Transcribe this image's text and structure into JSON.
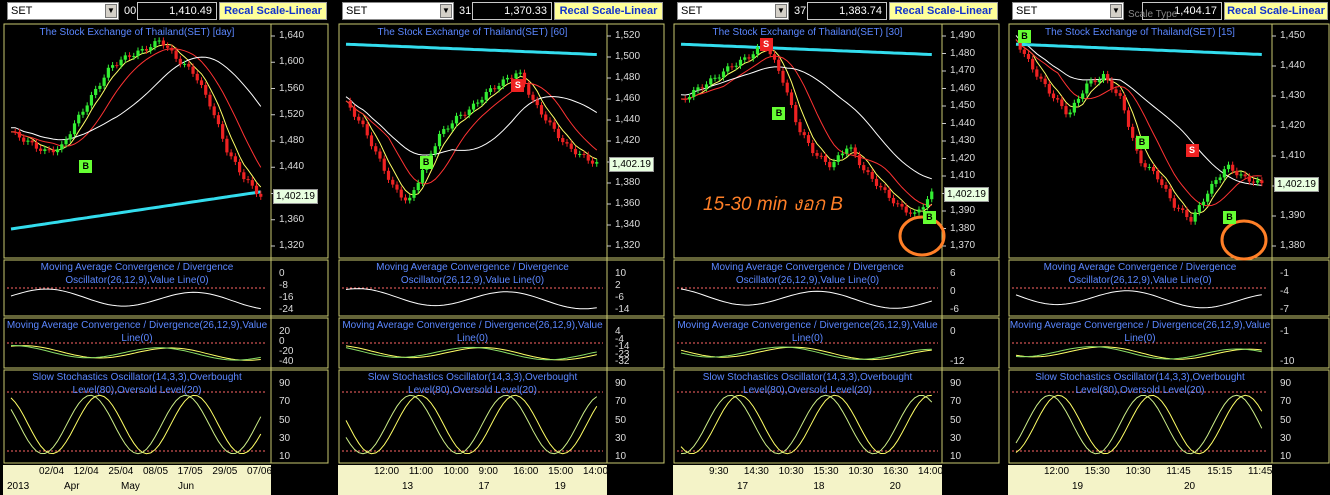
{
  "panels": [
    {
      "symbol": "SET",
      "price_tail": "00",
      "price": "1,410.49",
      "scale_label": "Recal Scale-Linear",
      "title": "The Stock Exchange of Thailand(SET) [day]",
      "price_ticks": [
        "1,640",
        "1,600",
        "1,560",
        "1,520",
        "1,480",
        "1,440",
        "1,400",
        "1,360",
        "1,320"
      ],
      "last_price": "1,402.19",
      "signals": [
        {
          "label": "B"
        }
      ],
      "macd1_title": "Moving Average Convergence / Divergence Oscillator(26,12,9),Value Line(0)",
      "macd1_ticks": [
        "0",
        "-8",
        "-16",
        "-24"
      ],
      "macd2_title": "Moving Average Convergence / Divergence(26,12,9),Value Line(0)",
      "macd2_ticks": [
        "20",
        "0",
        "-20",
        "-40"
      ],
      "stoch_title": "Slow Stochastics Oscillator(14,3,3),Overbought Level(80),Oversold Level(20)",
      "stoch_ticks": [
        "90",
        "70",
        "50",
        "30",
        "10"
      ],
      "time_top": [
        "02/04",
        "12/04",
        "25/04",
        "08/05",
        "17/05",
        "29/05",
        "07/06"
      ],
      "time_bottom": [
        "2013",
        "Apr",
        "May",
        "Jun"
      ]
    },
    {
      "symbol": "SET",
      "price_tail": "31",
      "price": "1,370.33",
      "scale_label": "Recal Scale-Linear",
      "title": "The Stock Exchange of Thailand(SET) [60]",
      "price_ticks": [
        "1,520",
        "1,500",
        "1,480",
        "1,460",
        "1,440",
        "1,420",
        "1,400",
        "1,380",
        "1,360",
        "1,340",
        "1,320"
      ],
      "last_price": "1,402.19",
      "signals": [
        {
          "label": "B"
        },
        {
          "label": "S"
        }
      ],
      "macd1_title": "Moving Average Convergence / Divergence Oscillator(26,12,9),Value Line(0)",
      "macd1_ticks": [
        "10",
        "2",
        "-6",
        "-14"
      ],
      "macd2_title": "Moving Average Convergence / Divergence(26,12,9),Value Line(0)",
      "macd2_ticks": [
        "4",
        "-4",
        "-14",
        "-23",
        "-32"
      ],
      "stoch_title": "Slow Stochastics Oscillator(14,3,3),Overbought Level(80),Oversold Level(20)",
      "stoch_ticks": [
        "90",
        "70",
        "50",
        "30",
        "10"
      ],
      "time_top": [
        "12:00",
        "11:00",
        "10:00",
        "9:00",
        "16:00",
        "15:00",
        "14:00"
      ],
      "time_bottom": [
        "13",
        "17",
        "19"
      ]
    },
    {
      "symbol": "SET",
      "price_tail": "37",
      "price": "1,383.74",
      "scale_label": "Recal Scale-Linear",
      "title": "The Stock Exchange of Thailand(SET) [30]",
      "price_ticks": [
        "1,490",
        "1,480",
        "1,470",
        "1,460",
        "1,450",
        "1,440",
        "1,430",
        "1,420",
        "1,410",
        "1,400",
        "1,390",
        "1,380",
        "1,370"
      ],
      "last_price": "1,402.19",
      "signals": [
        {
          "label": "S"
        },
        {
          "label": "B"
        },
        {
          "label": "B"
        }
      ],
      "annotation": "15-30 min งอก B",
      "macd1_title": "Moving Average Convergence / Divergence Oscillator(26,12,9),Value Line(0)",
      "macd1_ticks": [
        "6",
        "0",
        "-6"
      ],
      "macd2_title": "Moving Average Convergence / Divergence(26,12,9),Value Line(0)",
      "macd2_ticks": [
        "0",
        "-12"
      ],
      "stoch_title": "Slow Stochastics Oscillator(14,3,3),Overbought Level(80),Oversold Level(20)",
      "stoch_ticks": [
        "90",
        "70",
        "50",
        "30",
        "10"
      ],
      "time_top": [
        "9:30",
        "14:30",
        "10:30",
        "15:30",
        "10:30",
        "16:30",
        "14:00"
      ],
      "time_bottom": [
        "17",
        "18",
        "20"
      ]
    },
    {
      "symbol": "SET",
      "price_tail": "",
      "price": "1,404.17",
      "scale_label": "Recal Scale-Linear",
      "title": "The Stock Exchange of Thailand(SET) [15]",
      "overlay_text": "Scale Type",
      "price_ticks": [
        "1,450",
        "1,440",
        "1,430",
        "1,420",
        "1,410",
        "1,400",
        "1,390",
        "1,380"
      ],
      "last_price": "1,402.19",
      "signals": [
        {
          "label": "B"
        },
        {
          "label": "B"
        },
        {
          "label": "S"
        },
        {
          "label": "B"
        }
      ],
      "macd1_title": "Moving Average Convergence / Divergence Oscillator(26,12,9),Value Line(0)",
      "macd1_ticks": [
        "-1",
        "-4",
        "-7"
      ],
      "macd2_title": "Moving Average Convergence / Divergence(26,12,9),Value Line(0)",
      "macd2_ticks": [
        "-1",
        "-10"
      ],
      "stoch_title": "Slow Stochastics Oscillator(14,3,3),Overbought Level(80),Oversold Level(20)",
      "stoch_ticks": [
        "90",
        "70",
        "50",
        "30",
        "10"
      ],
      "time_top": [
        "12:00",
        "15:30",
        "10:30",
        "11:45",
        "15:15",
        "11:45"
      ],
      "time_bottom": [
        "19",
        "20"
      ]
    }
  ],
  "chart_data": [
    {
      "type": "line",
      "title": "The Stock Exchange of Thailand(SET) [day]",
      "y_range": [
        1320,
        1640
      ],
      "series": [
        {
          "values": [
            1500,
            1485,
            1470,
            1475,
            1520,
            1560,
            1600,
            1615,
            1625,
            1640,
            1610,
            1590,
            1540,
            1470,
            1430,
            1402
          ]
        }
      ]
    },
    {
      "type": "line",
      "title": "The Stock Exchange of Thailand(SET) [60]",
      "y_range": [
        1320,
        1520
      ],
      "series": [
        {
          "values": [
            1460,
            1440,
            1410,
            1380,
            1365,
            1400,
            1430,
            1445,
            1455,
            1470,
            1480,
            1490,
            1460,
            1440,
            1420,
            1410,
            1402
          ]
        }
      ]
    },
    {
      "type": "line",
      "title": "The Stock Exchange of Thailand(SET) [30]",
      "y_range": [
        1370,
        1490
      ],
      "series": [
        {
          "values": [
            1455,
            1462,
            1468,
            1475,
            1480,
            1488,
            1470,
            1440,
            1425,
            1418,
            1430,
            1415,
            1405,
            1395,
            1390,
            1402
          ]
        }
      ]
    },
    {
      "type": "line",
      "title": "The Stock Exchange of Thailand(SET) [15]",
      "y_range": [
        1380,
        1450
      ],
      "series": [
        {
          "values": [
            1450,
            1440,
            1432,
            1425,
            1435,
            1438,
            1430,
            1410,
            1405,
            1395,
            1390,
            1400,
            1408,
            1404,
            1402
          ]
        }
      ]
    }
  ]
}
